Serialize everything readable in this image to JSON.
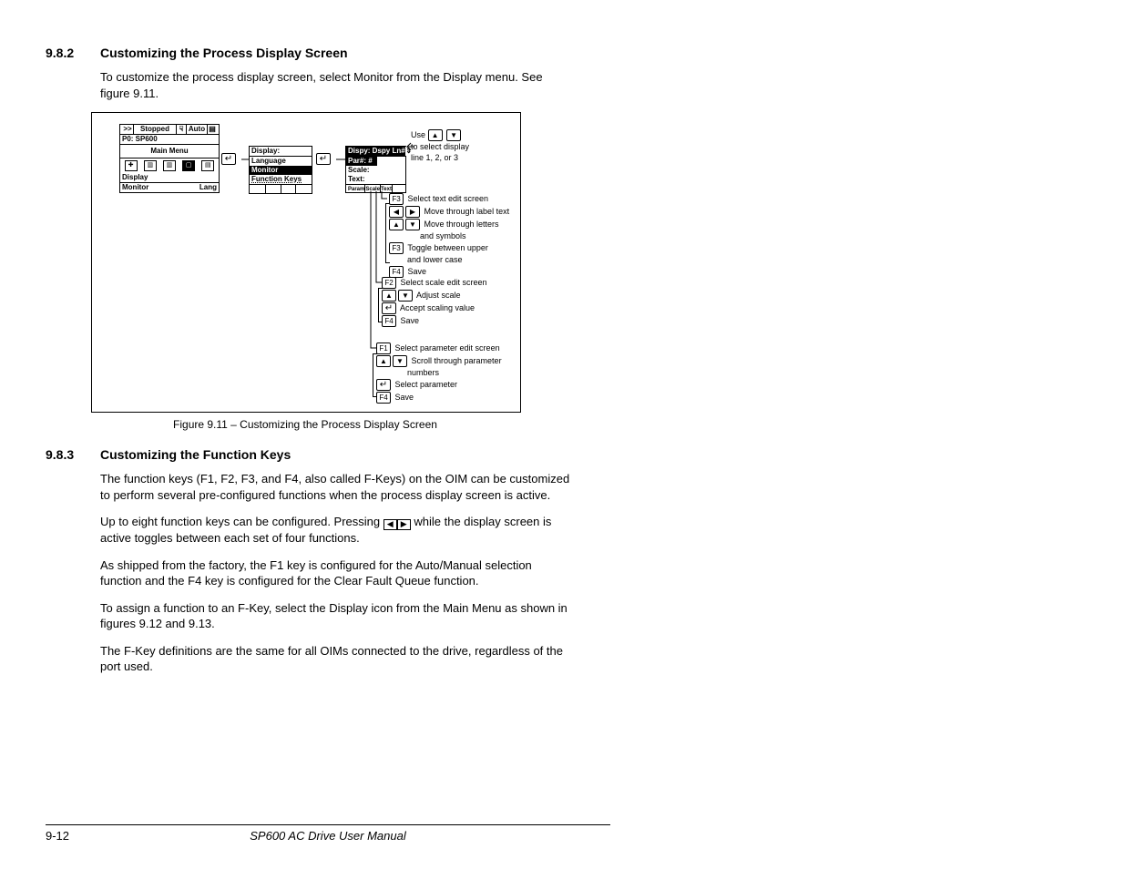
{
  "section1": {
    "num": "9.8.2",
    "title": "Customizing the Process Display Screen"
  },
  "p1": "To customize the process display screen, select Monitor from the Display menu. See figure 9.11.",
  "figcap": "Figure 9.11 – Customizing the Process Display Screen",
  "section2": {
    "num": "9.8.3",
    "title": "Customizing the Function Keys"
  },
  "p2": "The function keys (F1, F2, F3, and F4, also called F-Keys) on the OIM can be customized to perform several pre-configured functions when the process display screen is active.",
  "p3a": "Up to eight function keys can be configured. Pressing ",
  "p3b": " while the display screen is active toggles between each set of four functions.",
  "p4": "As shipped from the factory, the F1 key is configured for the Auto/Manual selection function and the F4 key is configured for the Clear Fault Queue function.",
  "p5": "To assign a function to an F-Key, select the Display icon from the Main Menu as shown in figures 9.12 and 9.13.",
  "p6": "The F-Key definitions are the same for all OIMs connected to the drive, regardless of the port used.",
  "footer": {
    "pagenum": "9-12",
    "manual": "SP600 AC Drive User Manual"
  },
  "fig": {
    "lcd1": {
      "r1a": ">>",
      "r1b": "Stopped",
      "r1c": "Auto",
      "r2": "P0: SP600",
      "r3": "Main Menu",
      "r5": "Display",
      "r6a": "Monitor",
      "r6b": "Lang"
    },
    "lcd2": {
      "t": "Display:",
      "a": "Language",
      "b": "Monitor",
      "c": "Function Keys"
    },
    "lcd3": {
      "t": "Dispy: Dspy Ln#",
      "a": "Par#: #",
      "b": "Scale:",
      "c": "Text:",
      "f1": "Param",
      "f2": "Scale",
      "f3": "Text"
    },
    "top": {
      "line1": "Use",
      "line2": "to select display",
      "line3": "line 1, 2, or 3"
    },
    "grp1": {
      "r1": "Select text edit screen",
      "r2": "Move through label text",
      "r3a": "Move through letters",
      "r3b": "and symbols",
      "r4a": "Toggle between upper",
      "r4b": "and lower case",
      "r5": "Save"
    },
    "grp2": {
      "r1": "Select scale edit screen",
      "r2": "Adjust scale",
      "r3": "Accept scaling value",
      "r4": "Save"
    },
    "grp3": {
      "r1": "Select parameter edit screen",
      "r2a": "Scroll through parameter",
      "r2b": "numbers",
      "r3": "Select parameter",
      "r4": "Save"
    },
    "keys": {
      "f1": "F1",
      "f2": "F2",
      "f3": "F3",
      "f4": "F4",
      "enter": "↵",
      "up": "▲",
      "down": "▼",
      "left": "◀",
      "right": "▶"
    }
  }
}
